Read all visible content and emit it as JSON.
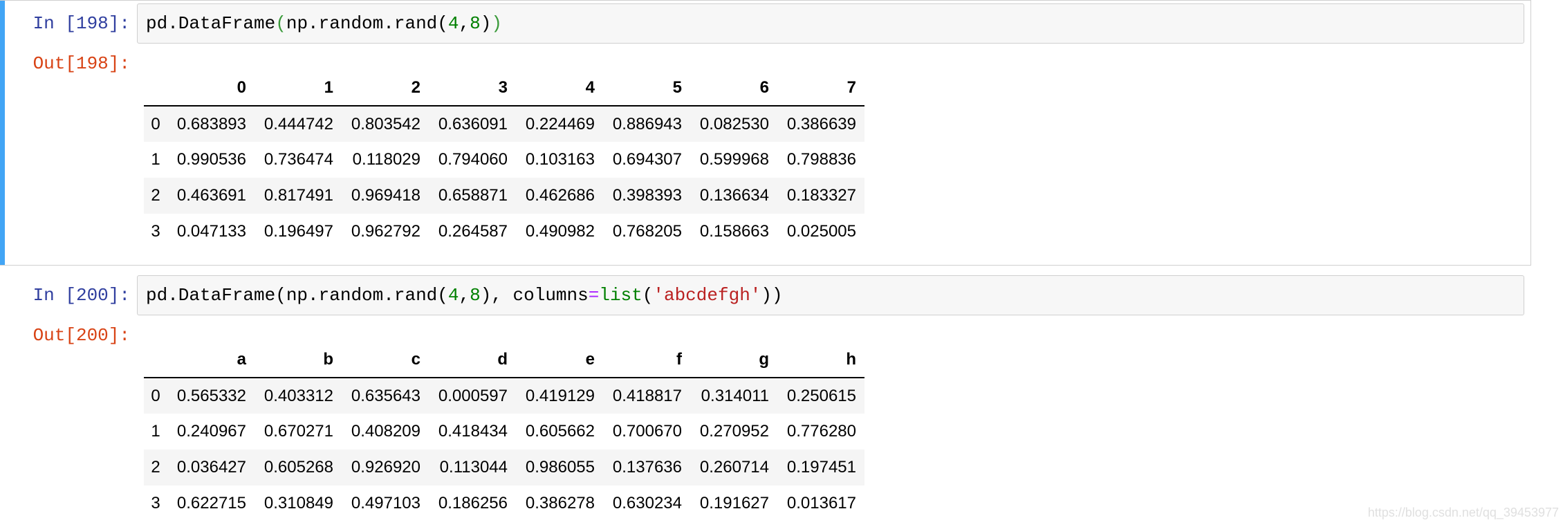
{
  "cells": [
    {
      "in_prompt": "In [198]:",
      "code": {
        "fn": "pd.DataFrame",
        "open": "(",
        "mid1": "np.random.rand(",
        "n1": "4",
        "comma": ",",
        "n2": "8",
        "close_inner": ")",
        "close": ")"
      },
      "out_prompt": "Out[198]:",
      "table": {
        "columns": [
          "0",
          "1",
          "2",
          "3",
          "4",
          "5",
          "6",
          "7"
        ],
        "rows": [
          {
            "index": "0",
            "values": [
              "0.683893",
              "0.444742",
              "0.803542",
              "0.636091",
              "0.224469",
              "0.886943",
              "0.082530",
              "0.386639"
            ]
          },
          {
            "index": "1",
            "values": [
              "0.990536",
              "0.736474",
              "0.118029",
              "0.794060",
              "0.103163",
              "0.694307",
              "0.599968",
              "0.798836"
            ]
          },
          {
            "index": "2",
            "values": [
              "0.463691",
              "0.817491",
              "0.969418",
              "0.658871",
              "0.462686",
              "0.398393",
              "0.136634",
              "0.183327"
            ]
          },
          {
            "index": "3",
            "values": [
              "0.047133",
              "0.196497",
              "0.962792",
              "0.264587",
              "0.490982",
              "0.768205",
              "0.158663",
              "0.025005"
            ]
          }
        ]
      }
    },
    {
      "in_prompt": "In [200]:",
      "code": {
        "fn": "pd.DataFrame(np.random.rand(",
        "n1": "4",
        "comma": ",",
        "n2": "8",
        "after": "), ",
        "kw": "columns",
        "eq": "=",
        "builtin": "list",
        "open": "(",
        "str": "'abcdefgh'",
        "close": "))"
      },
      "out_prompt": "Out[200]:",
      "table": {
        "columns": [
          "a",
          "b",
          "c",
          "d",
          "e",
          "f",
          "g",
          "h"
        ],
        "rows": [
          {
            "index": "0",
            "values": [
              "0.565332",
              "0.403312",
              "0.635643",
              "0.000597",
              "0.419129",
              "0.418817",
              "0.314011",
              "0.250615"
            ]
          },
          {
            "index": "1",
            "values": [
              "0.240967",
              "0.670271",
              "0.408209",
              "0.418434",
              "0.605662",
              "0.700670",
              "0.270952",
              "0.776280"
            ]
          },
          {
            "index": "2",
            "values": [
              "0.036427",
              "0.605268",
              "0.926920",
              "0.113044",
              "0.986055",
              "0.137636",
              "0.260714",
              "0.197451"
            ]
          },
          {
            "index": "3",
            "values": [
              "0.622715",
              "0.310849",
              "0.497103",
              "0.186256",
              "0.386278",
              "0.630234",
              "0.191627",
              "0.013617"
            ]
          }
        ]
      }
    }
  ],
  "watermark": "https://blog.csdn.net/qq_39453977",
  "colors": {
    "in_prompt": "#303f9f",
    "out_prompt": "#d84315",
    "selection_bar": "#42a5f5",
    "string": "#ba2121",
    "number": "#008000",
    "operator": "#aa22ff"
  }
}
